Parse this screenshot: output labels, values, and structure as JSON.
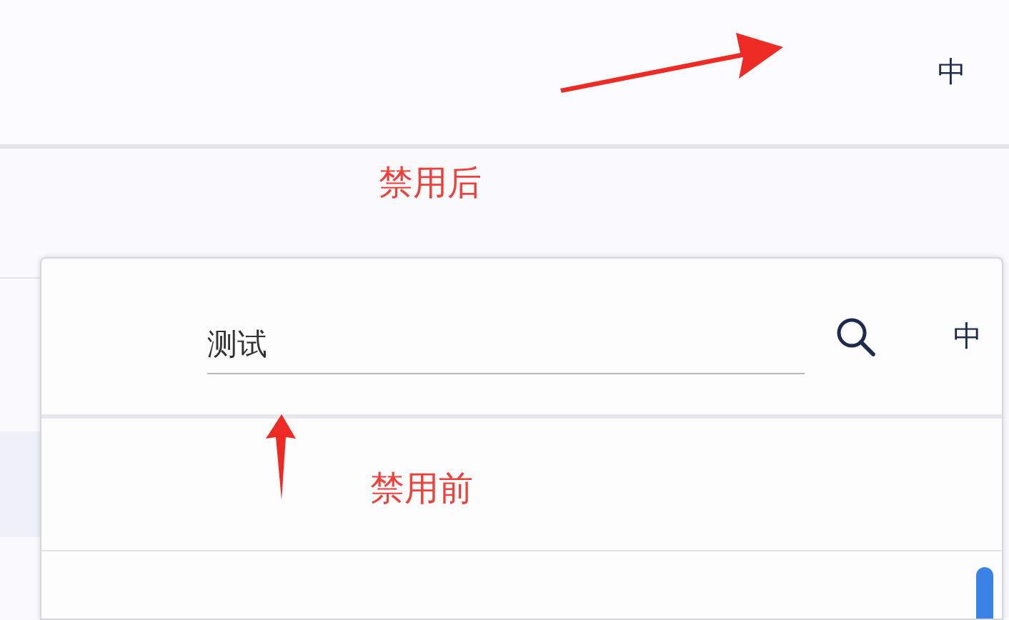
{
  "after": {
    "language_button": "中",
    "caption": "禁用后"
  },
  "before": {
    "search": {
      "value": "测试"
    },
    "language_button": "中",
    "caption": "禁用前"
  }
}
